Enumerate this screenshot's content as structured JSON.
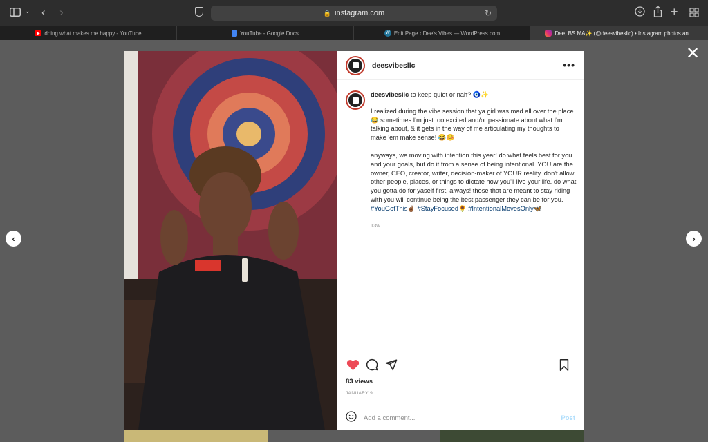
{
  "browser": {
    "url": "instagram.com",
    "tabs": [
      {
        "label": "doing what makes me happy - YouTube",
        "favicon": "youtube-icon",
        "color": "#ff0000"
      },
      {
        "label": "YouTube - Google Docs",
        "favicon": "docs-icon",
        "color": "#4285f4"
      },
      {
        "label": "Edit Page ‹ Dee's Vibes — WordPress.com",
        "favicon": "wordpress-icon",
        "color": "#21759b"
      },
      {
        "label": "Dee, BS MA✨ (@deesvibesllc) • Instagram photos an...",
        "favicon": "instagram-icon",
        "color": "#e1306c"
      }
    ]
  },
  "post": {
    "username": "deesvibesllc",
    "caption_head": "to keep quiet or nah? 🧿✨",
    "paragraph1": "I realized during the vibe session that ya girl was mad all over the place 😂 sometimes I'm just too excited and/or passionate about what I'm talking about, & it gets in the way of me articulating my thoughts to make 'em make sense! 😂🤒",
    "paragraph2": "anyways, we moving with intention this year! do what feels best for you and your goals, but do it from a sense of being intentional. YOU are the owner, CEO, creator, writer, decision-maker of YOUR reality. don't allow other people, places, or things to dictate how you'll live your life. do what you gotta do for yaself first, always! those that are meant to stay riding with you will continue being the best passenger they can be for you.",
    "hashtags": "#YouGotThis✌🏾 #StayFocused🌻 #IntentionalMovesOnly🦋",
    "time_ago": "13w",
    "views": "83 views",
    "date": "JANUARY 9",
    "comment_placeholder": "Add a comment...",
    "post_label": "Post",
    "liked": true,
    "like_color": "#ed4956"
  },
  "overlay": {
    "close_symbol": "✕",
    "prev_symbol": "‹",
    "next_symbol": "›"
  }
}
